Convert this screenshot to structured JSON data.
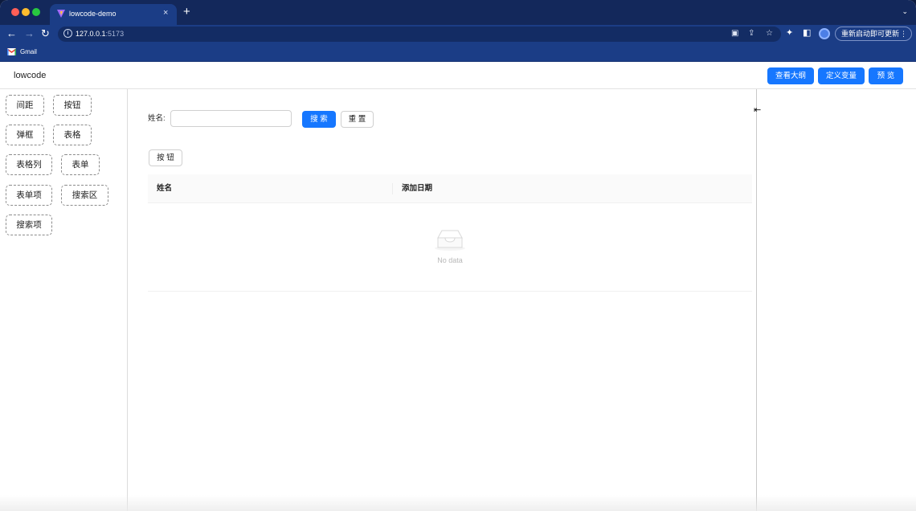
{
  "browser": {
    "tab_title": "lowcode-demo",
    "tab_close": "×",
    "new_tab": "+",
    "tab_menu": "⌄",
    "url_host": "127.0.0.1",
    "url_port": ":5173",
    "update_label": "重新启动即可更新",
    "bookmark_gmail": "Gmail",
    "icons": [
      "back-icon",
      "forward-icon",
      "reload-icon",
      "info-icon",
      "translate-icon",
      "share-icon",
      "star-icon",
      "extensions-icon",
      "sidepanel-icon",
      "profile-icon",
      "kebab-icon"
    ]
  },
  "header": {
    "title": "lowcode",
    "buttons": [
      "查看大纲",
      "定义变量",
      "预 览"
    ]
  },
  "components": [
    "间距",
    "按钮",
    "弹框",
    "表格",
    "表格列",
    "表单",
    "表单项",
    "搜索区",
    "搜索项"
  ],
  "canvas": {
    "search_label": "姓名:",
    "search_button": "搜 索",
    "reset_button": "重 置",
    "action_button": "按 钮",
    "table_columns": [
      "姓名",
      "添加日期"
    ],
    "empty_text": "No data"
  },
  "colors": {
    "primary": "#1677ff",
    "chrome_dark": "#13285b",
    "chrome_toolbar": "#1b3d86"
  }
}
